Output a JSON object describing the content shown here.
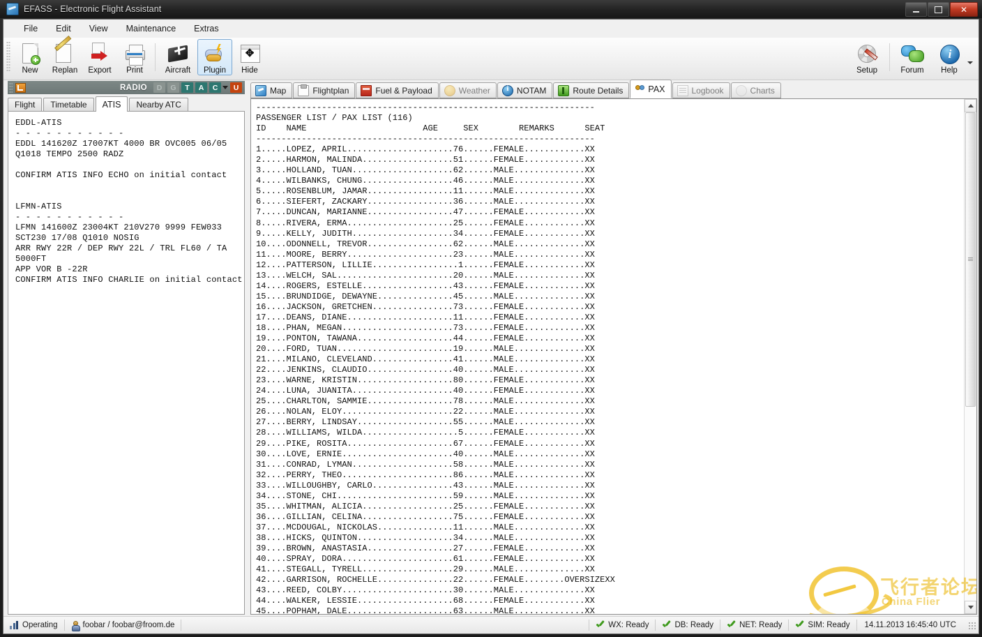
{
  "window": {
    "title": "EFASS - Electronic Flight Assistant",
    "app_icon": "efass-logo-icon",
    "minimize_label": "–",
    "maximize_label": "□",
    "close_label": "✕"
  },
  "menu": {
    "items": [
      {
        "label": "File"
      },
      {
        "label": "Edit"
      },
      {
        "label": "View"
      },
      {
        "label": "Maintenance"
      },
      {
        "label": "Extras"
      }
    ]
  },
  "toolbar": {
    "buttons": [
      {
        "label": "New",
        "icon": "new-document-icon"
      },
      {
        "label": "Replan",
        "icon": "pencil-edit-icon"
      },
      {
        "label": "Export",
        "icon": "export-arrow-icon"
      },
      {
        "label": "Print",
        "icon": "printer-icon"
      },
      {
        "label": "Aircraft",
        "icon": "aircraft-icon"
      },
      {
        "label": "Plugin",
        "icon": "plugin-lightning-icon"
      },
      {
        "label": "Hide",
        "icon": "hide-window-icon"
      }
    ],
    "right_buttons": [
      {
        "label": "Setup",
        "icon": "gear-wand-icon"
      },
      {
        "label": "Forum",
        "icon": "speech-bubbles-icon"
      },
      {
        "label": "Help",
        "icon": "info-circle-icon"
      }
    ]
  },
  "radio_bar": {
    "label": "RADIO",
    "indicators": [
      {
        "label": "D",
        "state": "off"
      },
      {
        "label": "G",
        "state": "off"
      },
      {
        "label": "T",
        "state": "on"
      },
      {
        "label": "A",
        "state": "on"
      },
      {
        "label": "C",
        "state": "on"
      },
      {
        "label": "U",
        "state": "alert"
      }
    ]
  },
  "left_panel": {
    "tabs": [
      {
        "label": "Flight",
        "active": false
      },
      {
        "label": "Timetable",
        "active": false
      },
      {
        "label": "ATIS",
        "active": true
      },
      {
        "label": "Nearby ATC",
        "active": false
      }
    ],
    "atis_text": "EDDL-ATIS\n- - - - - - - - - - -\nEDDL 141620Z 17007KT 4000 BR OVC005 06/05\nQ1018 TEMPO 2500 RADZ\n\nCONFIRM ATIS INFO ECHO on initial contact\n\n\nLFMN-ATIS\n- - - - - - - - - - -\nLFMN 141600Z 23004KT 210V270 9999 FEW033\nSCT230 17/08 Q1010 NOSIG\nARR RWY 22R / DEP RWY 22L / TRL FL60 / TA\n5000FT\nAPP VOR B -22R\nCONFIRM ATIS INFO CHARLIE on initial contact"
  },
  "main_panel": {
    "tabs": [
      {
        "label": "Map",
        "icon": "map-icon",
        "active": false,
        "dim": false
      },
      {
        "label": "Flightplan",
        "icon": "clipboard-icon",
        "active": false,
        "dim": false
      },
      {
        "label": "Fuel & Payload",
        "icon": "fuel-canister-icon",
        "active": false,
        "dim": false
      },
      {
        "label": "Weather",
        "icon": "weather-sun-icon",
        "active": false,
        "dim": true
      },
      {
        "label": "NOTAM",
        "icon": "info-circle-icon",
        "active": false,
        "dim": false
      },
      {
        "label": "Route Details",
        "icon": "route-pin-icon",
        "active": false,
        "dim": false
      },
      {
        "label": "PAX",
        "icon": "passengers-icon",
        "active": true,
        "dim": false
      },
      {
        "label": "Logbook",
        "icon": "logbook-icon",
        "active": false,
        "dim": true
      },
      {
        "label": "Charts",
        "icon": "charts-icon",
        "active": false,
        "dim": true
      }
    ],
    "pax_list": {
      "rule_top": "-------------------------------------------------------------------",
      "title": "PASSENGER LIST / PAX LIST (116)",
      "header": "ID    NAME                                AGE     SEX      REMARKS     SEAT",
      "rule_mid": "-------------------------------------------------------------------",
      "columns": [
        "ID",
        "NAME",
        "AGE",
        "SEX",
        "REMARKS",
        "SEAT"
      ],
      "count": 116,
      "rows": [
        {
          "id": 1,
          "name": "LOPEZ, APRIL",
          "age": 76,
          "sex": "FEMALE",
          "remarks": "",
          "seat": "XX"
        },
        {
          "id": 2,
          "name": "HARMON, MALINDA",
          "age": 51,
          "sex": "FEMALE",
          "remarks": "",
          "seat": "XX"
        },
        {
          "id": 3,
          "name": "HOLLAND, TUAN",
          "age": 62,
          "sex": "MALE",
          "remarks": "",
          "seat": "XX"
        },
        {
          "id": 4,
          "name": "WILBANKS, CHUNG",
          "age": 46,
          "sex": "MALE",
          "remarks": "",
          "seat": "XX"
        },
        {
          "id": 5,
          "name": "ROSENBLUM, JAMAR",
          "age": 11,
          "sex": "MALE",
          "remarks": "",
          "seat": "XX"
        },
        {
          "id": 6,
          "name": "SIEFERT, ZACKARY",
          "age": 36,
          "sex": "MALE",
          "remarks": "",
          "seat": "XX"
        },
        {
          "id": 7,
          "name": "DUNCAN, MARIANNE",
          "age": 47,
          "sex": "FEMALE",
          "remarks": "",
          "seat": "XX"
        },
        {
          "id": 8,
          "name": "RIVERA, ERMA",
          "age": 25,
          "sex": "FEMALE",
          "remarks": "",
          "seat": "XX"
        },
        {
          "id": 9,
          "name": "KELLY, JUDITH",
          "age": 34,
          "sex": "FEMALE",
          "remarks": "",
          "seat": "XX"
        },
        {
          "id": 10,
          "name": "ODONNELL, TREVOR",
          "age": 62,
          "sex": "MALE",
          "remarks": "",
          "seat": "XX"
        },
        {
          "id": 11,
          "name": "MOORE, BERRY",
          "age": 23,
          "sex": "MALE",
          "remarks": "",
          "seat": "XX"
        },
        {
          "id": 12,
          "name": "PATTERSON, LILLIE",
          "age": 1,
          "sex": "FEMALE",
          "remarks": "",
          "seat": "XX"
        },
        {
          "id": 13,
          "name": "WELCH, SAL",
          "age": 20,
          "sex": "MALE",
          "remarks": "",
          "seat": "XX"
        },
        {
          "id": 14,
          "name": "ROGERS, ESTELLE",
          "age": 43,
          "sex": "FEMALE",
          "remarks": "",
          "seat": "XX"
        },
        {
          "id": 15,
          "name": "BRUNDIDGE, DEWAYNE",
          "age": 45,
          "sex": "MALE",
          "remarks": "",
          "seat": "XX"
        },
        {
          "id": 16,
          "name": "JACKSON, GRETCHEN",
          "age": 73,
          "sex": "FEMALE",
          "remarks": "",
          "seat": "XX"
        },
        {
          "id": 17,
          "name": "DEANS, DIANE",
          "age": 11,
          "sex": "FEMALE",
          "remarks": "",
          "seat": "XX"
        },
        {
          "id": 18,
          "name": "PHAN, MEGAN",
          "age": 73,
          "sex": "FEMALE",
          "remarks": "",
          "seat": "XX"
        },
        {
          "id": 19,
          "name": "PONTON, TAWANA",
          "age": 44,
          "sex": "FEMALE",
          "remarks": "",
          "seat": "XX"
        },
        {
          "id": 20,
          "name": "FORD, TUAN",
          "age": 19,
          "sex": "MALE",
          "remarks": "",
          "seat": "XX"
        },
        {
          "id": 21,
          "name": "MILANO, CLEVELAND",
          "age": 41,
          "sex": "MALE",
          "remarks": "",
          "seat": "XX"
        },
        {
          "id": 22,
          "name": "JENKINS, CLAUDIO",
          "age": 40,
          "sex": "MALE",
          "remarks": "",
          "seat": "XX"
        },
        {
          "id": 23,
          "name": "WARNE, KRISTIN",
          "age": 80,
          "sex": "FEMALE",
          "remarks": "",
          "seat": "XX"
        },
        {
          "id": 24,
          "name": "LUNA, JUANITA",
          "age": 40,
          "sex": "FEMALE",
          "remarks": "",
          "seat": "XX"
        },
        {
          "id": 25,
          "name": "CHARLTON, SAMMIE",
          "age": 78,
          "sex": "MALE",
          "remarks": "",
          "seat": "XX"
        },
        {
          "id": 26,
          "name": "NOLAN, ELOY",
          "age": 22,
          "sex": "MALE",
          "remarks": "",
          "seat": "XX"
        },
        {
          "id": 27,
          "name": "BERRY, LINDSAY",
          "age": 55,
          "sex": "MALE",
          "remarks": "",
          "seat": "XX"
        },
        {
          "id": 28,
          "name": "WILLIAMS, WILDA",
          "age": 5,
          "sex": "FEMALE",
          "remarks": "",
          "seat": "XX"
        },
        {
          "id": 29,
          "name": "PIKE, ROSITA",
          "age": 67,
          "sex": "FEMALE",
          "remarks": "",
          "seat": "XX"
        },
        {
          "id": 30,
          "name": "LOVE, ERNIE",
          "age": 40,
          "sex": "MALE",
          "remarks": "",
          "seat": "XX"
        },
        {
          "id": 31,
          "name": "CONRAD, LYMAN",
          "age": 58,
          "sex": "MALE",
          "remarks": "",
          "seat": "XX"
        },
        {
          "id": 32,
          "name": "PERRY, THEO",
          "age": 86,
          "sex": "MALE",
          "remarks": "",
          "seat": "XX"
        },
        {
          "id": 33,
          "name": "WILLOUGHBY, CARLO",
          "age": 43,
          "sex": "MALE",
          "remarks": "",
          "seat": "XX"
        },
        {
          "id": 34,
          "name": "STONE, CHI",
          "age": 59,
          "sex": "MALE",
          "remarks": "",
          "seat": "XX"
        },
        {
          "id": 35,
          "name": "WHITMAN, ALICIA",
          "age": 25,
          "sex": "FEMALE",
          "remarks": "",
          "seat": "XX"
        },
        {
          "id": 36,
          "name": "GILLIAN, CELINA",
          "age": 75,
          "sex": "FEMALE",
          "remarks": "",
          "seat": "XX"
        },
        {
          "id": 37,
          "name": "MCDOUGAL, NICKOLAS",
          "age": 11,
          "sex": "MALE",
          "remarks": "",
          "seat": "XX"
        },
        {
          "id": 38,
          "name": "HICKS, QUINTON",
          "age": 34,
          "sex": "MALE",
          "remarks": "",
          "seat": "XX"
        },
        {
          "id": 39,
          "name": "BROWN, ANASTASIA",
          "age": 27,
          "sex": "FEMALE",
          "remarks": "",
          "seat": "XX"
        },
        {
          "id": 40,
          "name": "SPRAY, DORA",
          "age": 61,
          "sex": "FEMALE",
          "remarks": "",
          "seat": "XX"
        },
        {
          "id": 41,
          "name": "STEGALL, TYRELL",
          "age": 29,
          "sex": "MALE",
          "remarks": "",
          "seat": "XX"
        },
        {
          "id": 42,
          "name": "GARRISON, ROCHELLE",
          "age": 22,
          "sex": "FEMALE",
          "remarks": "OVERSIZE",
          "seat": "XX"
        },
        {
          "id": 43,
          "name": "REED, COLBY",
          "age": 30,
          "sex": "MALE",
          "remarks": "",
          "seat": "XX"
        },
        {
          "id": 44,
          "name": "WALKER, LESSIE",
          "age": 68,
          "sex": "FEMALE",
          "remarks": "",
          "seat": "XX"
        },
        {
          "id": 45,
          "name": "POPHAM, DALE",
          "age": 63,
          "sex": "MALE",
          "remarks": "",
          "seat": "XX"
        }
      ]
    }
  },
  "watermark": {
    "chinese": "飞行者论坛",
    "english": "China Flier"
  },
  "status_bar": {
    "operating_label": "Operating",
    "operating_icon": "signal-bars-icon",
    "user_icon": "user-icon",
    "user": "foobar / foobar@froom.de",
    "indicators": [
      {
        "label": "WX: Ready"
      },
      {
        "label": "DB: Ready"
      },
      {
        "label": "NET: Ready"
      },
      {
        "label": "SIM: Ready"
      }
    ],
    "timestamp": "14.11.2013 16:45:40 UTC"
  },
  "colors": {
    "accent_teal": "#2d7770",
    "accent_alert": "#c4440f",
    "title_bg": "#222222",
    "close_red": "#c23a22",
    "watermark_yellow": "#ebb919"
  }
}
